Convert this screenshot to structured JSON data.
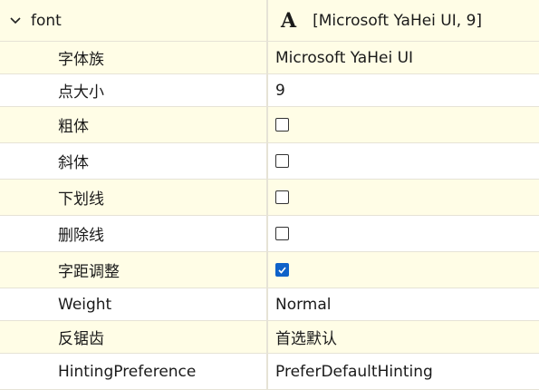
{
  "group": {
    "name": "font",
    "value": "[Microsoft YaHei UI, 9]",
    "font_glyph": "A"
  },
  "props": {
    "family": {
      "label": "字体族",
      "value": "Microsoft YaHei UI"
    },
    "size": {
      "label": "点大小",
      "value": "9"
    },
    "bold": {
      "label": "粗体",
      "checked": false
    },
    "italic": {
      "label": "斜体",
      "checked": false
    },
    "underline": {
      "label": "下划线",
      "checked": false
    },
    "strikeout": {
      "label": "删除线",
      "checked": false
    },
    "kerning": {
      "label": "字距调整",
      "checked": true
    },
    "weight": {
      "label": "Weight",
      "value": "Normal"
    },
    "antialias": {
      "label": "反锯齿",
      "value": "首选默认"
    },
    "hinting": {
      "label": "HintingPreference",
      "value": "PreferDefaultHinting"
    }
  },
  "colors": {
    "row_yellow": "#fffde6",
    "grid_line": "#e6e3d6",
    "checkbox_checked": "#0f62c9"
  }
}
